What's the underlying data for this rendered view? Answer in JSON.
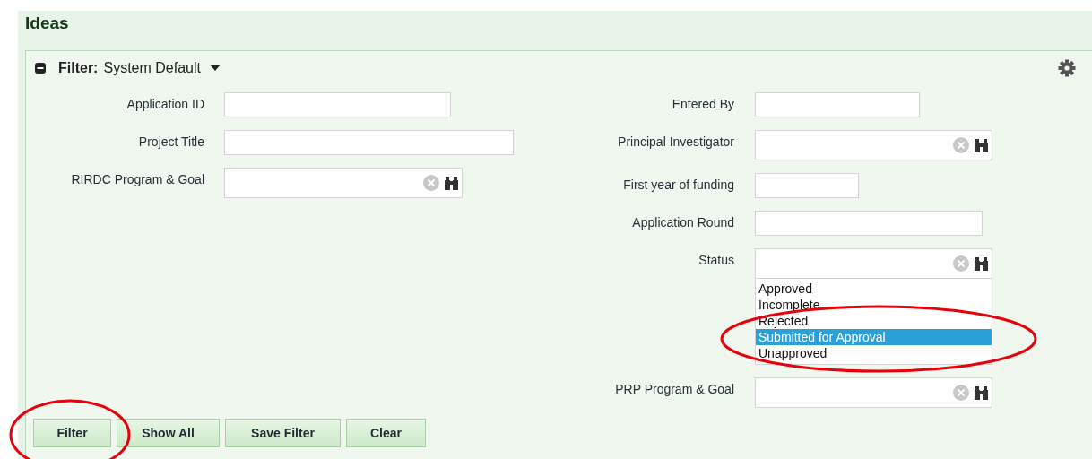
{
  "page": {
    "title": "Ideas"
  },
  "filter": {
    "label": "Filter:",
    "name": "System Default",
    "expanded": true
  },
  "left_fields": [
    {
      "label": "Application ID",
      "kind": "text"
    },
    {
      "label": "Project Title",
      "kind": "text"
    },
    {
      "label": "RIRDC Program & Goal",
      "kind": "lookup"
    }
  ],
  "right_fields": [
    {
      "label": "Entered By",
      "kind": "text"
    },
    {
      "label": "Principal Investigator",
      "kind": "lookup"
    },
    {
      "label": "First year of funding",
      "kind": "text"
    },
    {
      "label": "Application Round",
      "kind": "text"
    },
    {
      "label": "Status",
      "kind": "lookup",
      "options": [
        {
          "label": "Approved",
          "selected": false
        },
        {
          "label": "Incomplete",
          "selected": false
        },
        {
          "label": "Rejected",
          "selected": false
        },
        {
          "label": "Submitted for Approval",
          "selected": true
        },
        {
          "label": "Unapproved",
          "selected": false
        }
      ]
    },
    {
      "label": "PRP Program & Goal",
      "kind": "lookup"
    }
  ],
  "buttons": [
    "Filter",
    "Show All",
    "Save Filter",
    "Clear"
  ]
}
